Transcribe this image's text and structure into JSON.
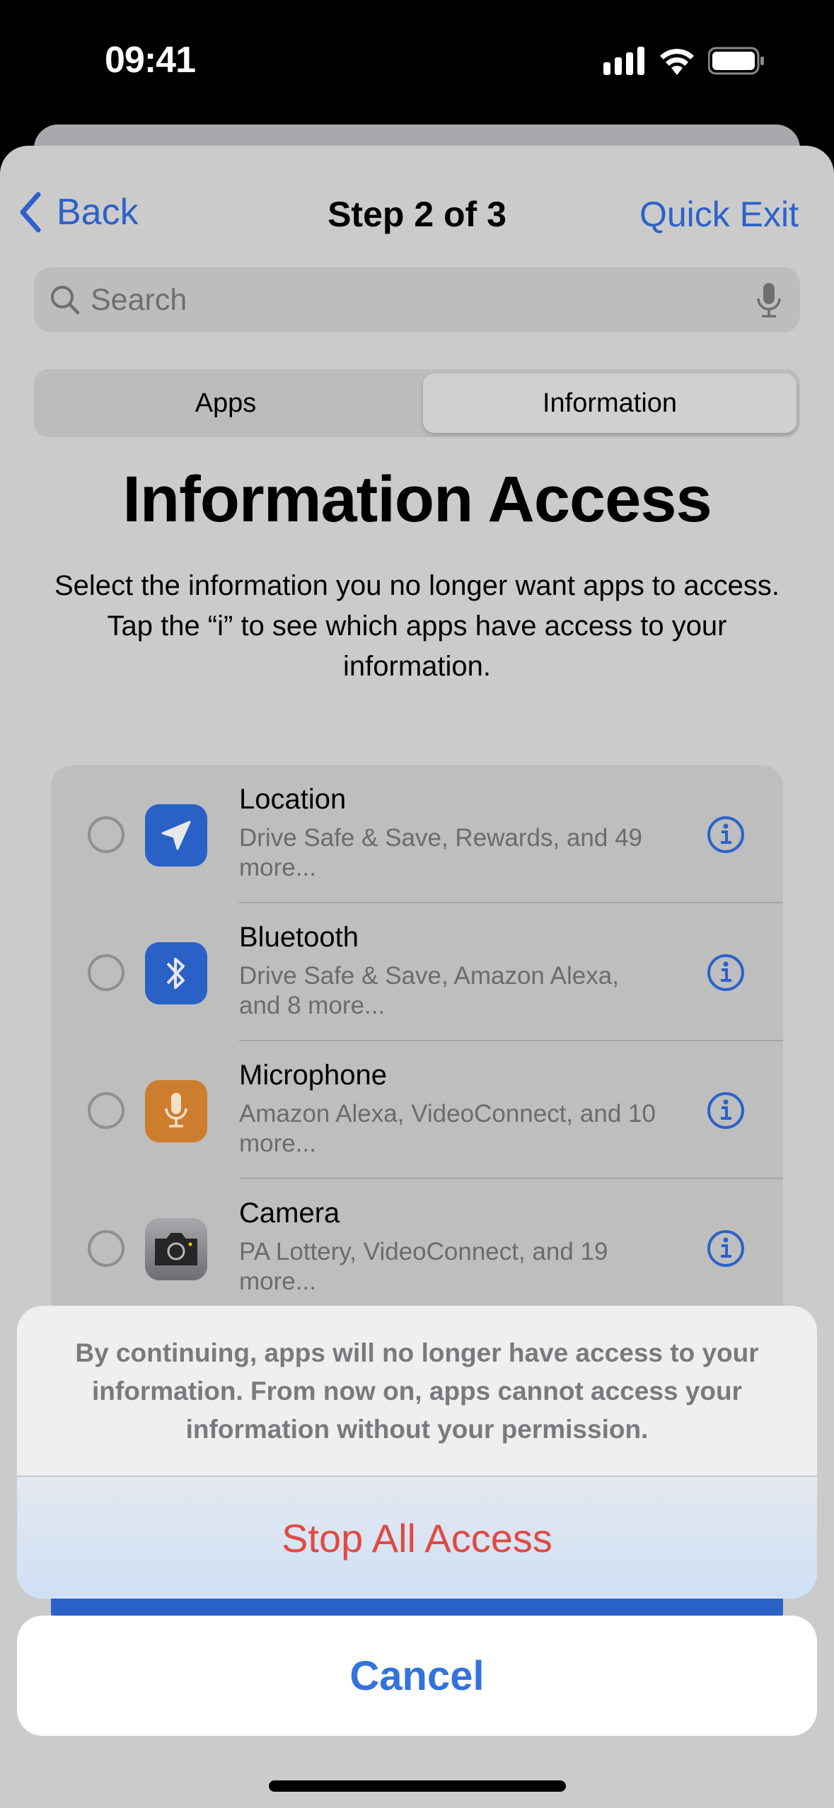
{
  "status_bar": {
    "time": "09:41",
    "icons": [
      "cellular-signal-icon",
      "wifi-icon",
      "battery-icon"
    ]
  },
  "nav": {
    "back_label": "Back",
    "title": "Step 2 of 3",
    "quick_exit_label": "Quick Exit"
  },
  "search": {
    "placeholder": "Search",
    "value": ""
  },
  "segments": [
    {
      "label": "Apps",
      "selected": false
    },
    {
      "label": "Information",
      "selected": true
    }
  ],
  "page": {
    "title": "Information Access",
    "description": "Select the information you no longer want apps to access. Tap the “i” to see which apps have access to your information."
  },
  "items": [
    {
      "title": "Location",
      "subtitle": "Drive Safe & Save, Rewards, and 49 more...",
      "icon": "location-arrow-icon",
      "icon_color": "#2a61c6",
      "selected": false
    },
    {
      "title": "Bluetooth",
      "subtitle": "Drive Safe & Save, Amazon Alexa, and 8 more...",
      "icon": "bluetooth-icon",
      "icon_color": "#2a61c6",
      "selected": false
    },
    {
      "title": "Microphone",
      "subtitle": "Amazon Alexa, VideoConnect, and 10 more...",
      "icon": "microphone-icon",
      "icon_color": "#cc7d2e",
      "selected": false
    },
    {
      "title": "Camera",
      "subtitle": "PA Lottery, VideoConnect, and 19 more...",
      "icon": "camera-icon",
      "icon_color": "#8a8a8e",
      "selected": false
    }
  ],
  "alert": {
    "message": "By continuing, apps will no longer have access to your information. From now on, apps cannot access your information without your permission.",
    "destructive_label": "Stop All Access",
    "cancel_label": "Cancel"
  },
  "colors": {
    "accent": "#2c62c9",
    "destructive": "#e04a42",
    "cancel": "#3472dc"
  }
}
